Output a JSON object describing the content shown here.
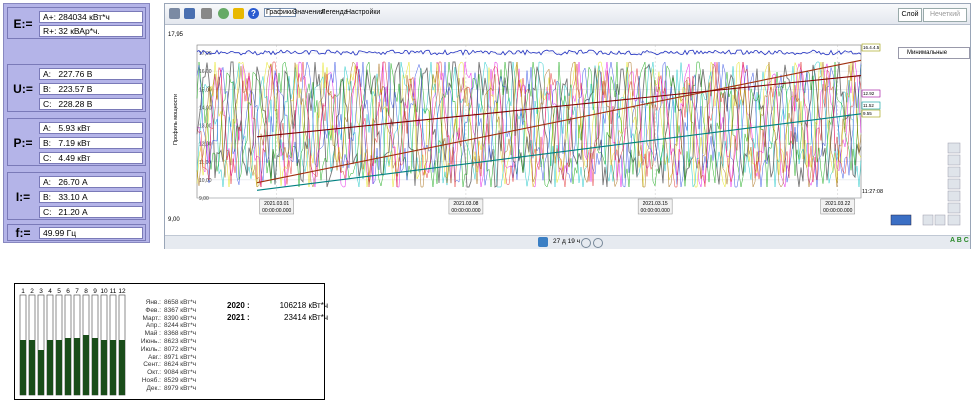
{
  "meters": {
    "E": {
      "symbol": "E:=",
      "rows": [
        {
          "label": "A+:",
          "value": "284034 кВт*ч"
        },
        {
          "label": "R+:",
          "value": "32 кВАр*ч."
        }
      ]
    },
    "U": {
      "symbol": "U:=",
      "rows": [
        {
          "label": "A:",
          "value": "227.76 В"
        },
        {
          "label": "B:",
          "value": "223.57 В"
        },
        {
          "label": "C:",
          "value": "228.28 В"
        }
      ]
    },
    "P": {
      "symbol": "P:=",
      "rows": [
        {
          "label": "A:",
          "value": "5.93 кВт"
        },
        {
          "label": "B:",
          "value": "7.19 кВт"
        },
        {
          "label": "C:",
          "value": "4.49 кВт"
        }
      ]
    },
    "I": {
      "symbol": "I:=",
      "rows": [
        {
          "label": "A:",
          "value": "26.70 А"
        },
        {
          "label": "B:",
          "value": "33.10 А"
        },
        {
          "label": "C:",
          "value": "21.20 А"
        }
      ]
    },
    "F": {
      "symbol": "f:=",
      "value": "49.99 Гц"
    }
  },
  "toolbar": {
    "menu": [
      "Графики",
      "Значения",
      "Легенда",
      "Настройки"
    ],
    "layer_button": "Слой",
    "mode_button": "Нечеткий",
    "dropdown_value": "Минимальные"
  },
  "plot": {
    "y_top": "17,95",
    "y_bottom": "9,00",
    "y_axis_label": "Профиль мощности",
    "y_ticks": [
      "17,00",
      "16,00",
      "15,00",
      "14,00",
      "13,00",
      "12,00",
      "11,00",
      "10,00",
      "9,00"
    ],
    "x_ticks": [
      {
        "date": "2021.03.01",
        "time": "00:00:00.000"
      },
      {
        "date": "2021.03.08",
        "time": "00:00:00.000"
      },
      {
        "date": "2021.03.15",
        "time": "00:00:00.000"
      },
      {
        "date": "2021.03.22",
        "time": "00:00:00.000"
      }
    ],
    "right_labels": [
      "16.4.4.5",
      "12.92",
      "11.52",
      "9.55"
    ],
    "end_time": "11:27:08",
    "status_text": "27 д 19 ч"
  },
  "monthly": {
    "month_numbers": [
      "1",
      "2",
      "3",
      "4",
      "5",
      "6",
      "7",
      "8",
      "9",
      "10",
      "11",
      "12"
    ],
    "bar_fractions": [
      0.55,
      0.55,
      0.45,
      0.55,
      0.55,
      0.57,
      0.57,
      0.6,
      0.57,
      0.55,
      0.55,
      0.55
    ],
    "months": [
      {
        "name": "Янв.:",
        "value": "8658 кВт*ч"
      },
      {
        "name": "Фев.:",
        "value": "8367 кВт*ч"
      },
      {
        "name": "Март.:",
        "value": "8390 кВт*ч"
      },
      {
        "name": "Апр.:",
        "value": "8244 кВт*ч"
      },
      {
        "name": "Май :",
        "value": "8368 кВт*ч"
      },
      {
        "name": "Июнь.:",
        "value": "8623 кВт*ч"
      },
      {
        "name": "Июль.:",
        "value": "8072 кВт*ч"
      },
      {
        "name": "Авг.:",
        "value": "8971 кВт*ч"
      },
      {
        "name": "Сент.:",
        "value": "8624 кВт*ч"
      },
      {
        "name": "Окт.:",
        "value": "9084 кВт*ч"
      },
      {
        "name": "Нояб.:",
        "value": "8529 кВт*ч"
      },
      {
        "name": "Дек.:",
        "value": "8979 кВт*ч"
      }
    ],
    "years": [
      {
        "year": "2020 :",
        "value": "106218 кВт*ч"
      },
      {
        "year": "2021 :",
        "value": "23414 кВт*ч"
      }
    ]
  },
  "colors": {
    "panel": "#b4b4e8",
    "bar": "#1a4d1a"
  }
}
